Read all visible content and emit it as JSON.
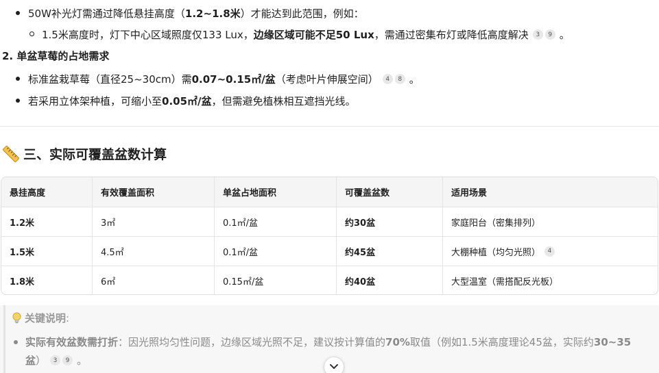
{
  "bullets_top": {
    "item1": {
      "a": "50W补光灯需通过降低悬挂高度（",
      "b": "1.2~1.8米",
      "c": "）才能达到此范围，例如："
    },
    "sub1": {
      "a": "1.5米高度时，灯下中心区域照度仅133 Lux，",
      "b": "边缘区域可能不足50 Lux",
      "c": "，需通过密集布灯或降低高度解决",
      "cites": [
        "3",
        "9"
      ],
      "end": "。"
    }
  },
  "section2": {
    "title": "2. 单盆草莓的占地需求",
    "item1": {
      "a": "标准盆栽草莓（直径25~30cm）需",
      "b": "0.07~0.15㎡/盆",
      "c": "（考虑叶片伸展空间）",
      "cites": [
        "4",
        "8"
      ],
      "end": "。"
    },
    "item2": {
      "a": "若采用立体架种植，可缩小至",
      "b": "0.05㎡/盆",
      "c": "，但需避免植株相互遮挡光线。"
    }
  },
  "section3": {
    "icon": "ruler-icon",
    "title": "三、实际可覆盖盆数计算"
  },
  "table": {
    "headers": [
      "悬挂高度",
      "有效覆盖面积",
      "单盆占地面积",
      "可覆盖盆数",
      "适用场景"
    ],
    "rows": [
      {
        "height": "1.2米",
        "area": "3㎡",
        "per_pot": "0.1㎡/盆",
        "pots": "约30盆",
        "scene": "家庭阳台（密集排列）",
        "cite": ""
      },
      {
        "height": "1.5米",
        "area": "4.5㎡",
        "per_pot": "0.1㎡/盆",
        "pots": "约45盆",
        "scene": "大棚种植（均匀光照）",
        "cite": "4"
      },
      {
        "height": "1.8米",
        "area": "6㎡",
        "per_pot": "0.15㎡/盆",
        "pots": "约40盆",
        "scene": "大型温室（需搭配反光板）",
        "cite": ""
      }
    ]
  },
  "note": {
    "title": "关键说明",
    "colon": ":",
    "item1": {
      "b1": "实际有效盆数需打折",
      "a": "：因光照均匀性问题，边缘区域光照不足，建议按计算值的",
      "b2": "70%",
      "c": " 取值（例如1.5米高度理论45盆，实际约",
      "b3": "30~35",
      "line2_b": "盆",
      "line2_c": "）",
      "cites": [
        "3",
        "9"
      ],
      "end": "。"
    }
  },
  "colors": {
    "text": "#1f1f1f",
    "muted": "#8a8a8a",
    "border": "#e4e4e4",
    "header_bg": "#f5f5f5"
  }
}
